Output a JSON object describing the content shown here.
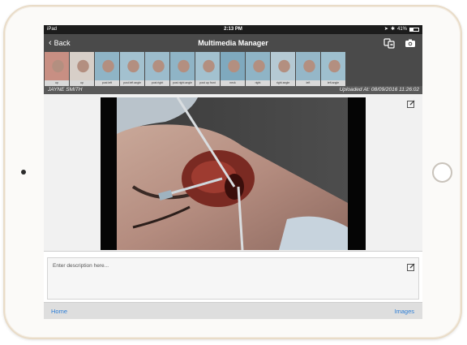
{
  "status_bar": {
    "carrier": "iPad",
    "time": "2:13 PM",
    "battery": "41%"
  },
  "navbar": {
    "back_label": "Back",
    "title": "Multimedia Manager",
    "icons": [
      "transfer-icon",
      "camera-icon"
    ]
  },
  "thumbnails": [
    {
      "caption": "op"
    },
    {
      "caption": "op"
    },
    {
      "caption": "post left"
    },
    {
      "caption": "post left angle"
    },
    {
      "caption": "post right"
    },
    {
      "caption": "post right angle"
    },
    {
      "caption": "post up front"
    },
    {
      "caption": "neck"
    },
    {
      "caption": "right"
    },
    {
      "caption": "right angle"
    },
    {
      "caption": "left"
    },
    {
      "caption": "left angle"
    }
  ],
  "patient": {
    "name": "JAYNE SMITH",
    "uploaded": "Uploaded At: 08/09/2016 11:26:02"
  },
  "description": {
    "placeholder": "Enter description here..."
  },
  "bottom_bar": {
    "home_label": "Home",
    "images_label": "Images"
  },
  "colors": {
    "nav_dark": "#4a4a4a",
    "status_dark": "#1c1c1c",
    "link_blue": "#2d7ed6"
  }
}
